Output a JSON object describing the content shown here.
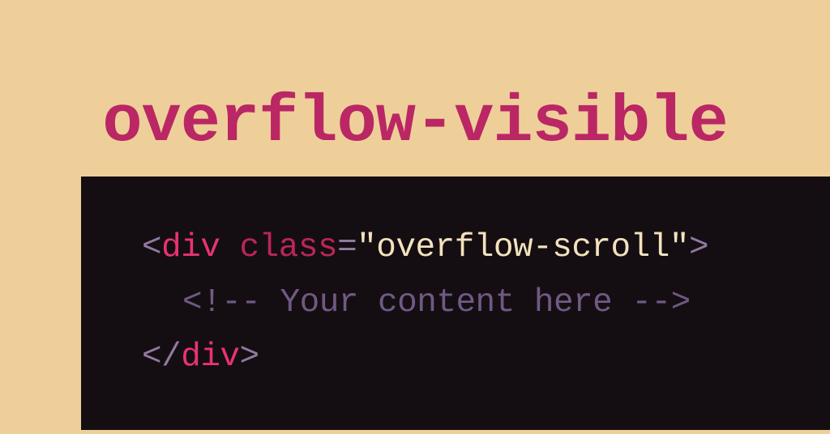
{
  "heading": "overflow-visible",
  "code": {
    "line1": {
      "open_bracket": "<",
      "tag": "div",
      "space": " ",
      "attr": "class",
      "equals": "=",
      "quote_open": "\"",
      "string": "overflow-scroll",
      "quote_close": "\"",
      "close_bracket": ">"
    },
    "line2": {
      "comment": "<!-- Your content here -->"
    },
    "line3": {
      "open_bracket": "<",
      "slash": "/",
      "tag": "div",
      "close_bracket": ">"
    }
  }
}
